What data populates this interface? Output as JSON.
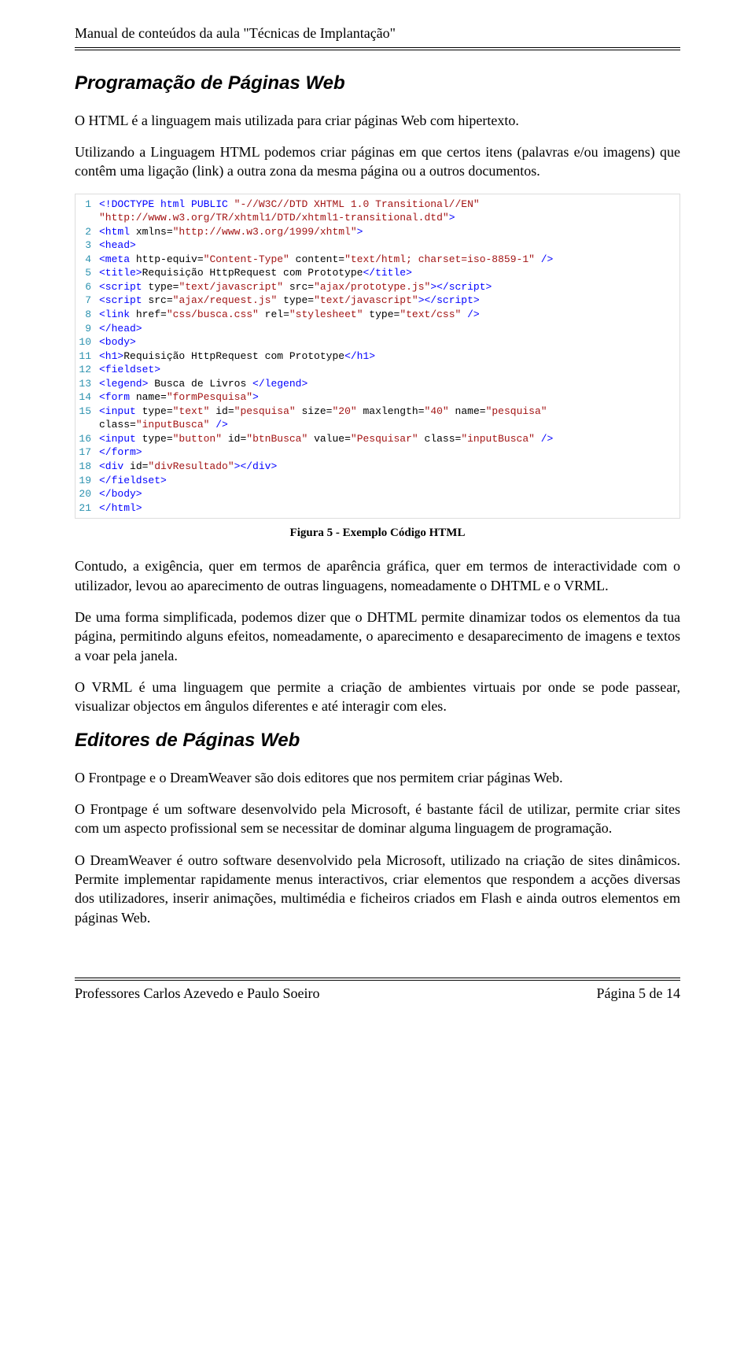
{
  "header": {
    "title": "Manual de conteúdos da aula \"Técnicas de Implantação\""
  },
  "section1": {
    "heading": "Programação de Páginas Web",
    "p1": "O HTML é a linguagem mais utilizada para criar páginas Web com hipertexto.",
    "p2": "Utilizando a Linguagem HTML podemos criar páginas em que certos itens (palavras e/ou imagens) que contêm uma ligação (link) a outra zona da mesma página ou a outros documentos."
  },
  "code": {
    "lines": [
      {
        "n": "1",
        "segs": [
          {
            "c": "blue",
            "t": "<!DOCTYPE html PUBLIC "
          },
          {
            "c": "brown",
            "t": "\"-//W3C//DTD XHTML 1.0 Transitional//EN\""
          }
        ]
      },
      {
        "n": "",
        "segs": [
          {
            "c": "brown",
            "t": "\"http://www.w3.org/TR/xhtml1/DTD/xhtml1-transitional.dtd\""
          },
          {
            "c": "blue",
            "t": ">"
          }
        ]
      },
      {
        "n": "2",
        "segs": [
          {
            "c": "blue",
            "t": "<html "
          },
          {
            "c": "black",
            "t": "xmlns="
          },
          {
            "c": "brown",
            "t": "\"http://www.w3.org/1999/xhtml\""
          },
          {
            "c": "blue",
            "t": ">"
          }
        ]
      },
      {
        "n": "3",
        "segs": [
          {
            "c": "blue",
            "t": "<head>"
          }
        ]
      },
      {
        "n": "4",
        "segs": [
          {
            "c": "blue",
            "t": "<meta "
          },
          {
            "c": "black",
            "t": "http-equiv="
          },
          {
            "c": "brown",
            "t": "\"Content-Type\""
          },
          {
            "c": "black",
            "t": " content="
          },
          {
            "c": "brown",
            "t": "\"text/html; charset=iso-8859-1\""
          },
          {
            "c": "blue",
            "t": " />"
          }
        ]
      },
      {
        "n": "5",
        "segs": [
          {
            "c": "blue",
            "t": "<title>"
          },
          {
            "c": "black",
            "t": "Requisição HttpRequest com Prototype"
          },
          {
            "c": "blue",
            "t": "</title>"
          }
        ]
      },
      {
        "n": "6",
        "segs": [
          {
            "c": "blue",
            "t": "<script "
          },
          {
            "c": "black",
            "t": "type="
          },
          {
            "c": "brown",
            "t": "\"text/javascript\""
          },
          {
            "c": "black",
            "t": " src="
          },
          {
            "c": "brown",
            "t": "\"ajax/prototype.js\""
          },
          {
            "c": "blue",
            "t": "></script>"
          }
        ]
      },
      {
        "n": "7",
        "segs": [
          {
            "c": "blue",
            "t": "<script "
          },
          {
            "c": "black",
            "t": "src="
          },
          {
            "c": "brown",
            "t": "\"ajax/request.js\""
          },
          {
            "c": "black",
            "t": " type="
          },
          {
            "c": "brown",
            "t": "\"text/javascript\""
          },
          {
            "c": "blue",
            "t": "></script>"
          }
        ]
      },
      {
        "n": "8",
        "segs": [
          {
            "c": "blue",
            "t": "<link "
          },
          {
            "c": "black",
            "t": "href="
          },
          {
            "c": "brown",
            "t": "\"css/busca.css\""
          },
          {
            "c": "black",
            "t": " rel="
          },
          {
            "c": "brown",
            "t": "\"stylesheet\""
          },
          {
            "c": "black",
            "t": " type="
          },
          {
            "c": "brown",
            "t": "\"text/css\""
          },
          {
            "c": "blue",
            "t": " />"
          }
        ]
      },
      {
        "n": "9",
        "segs": [
          {
            "c": "blue",
            "t": "</head>"
          }
        ]
      },
      {
        "n": "10",
        "segs": [
          {
            "c": "blue",
            "t": "<body>"
          }
        ]
      },
      {
        "n": "11",
        "segs": [
          {
            "c": "blue",
            "t": "<h1>"
          },
          {
            "c": "black",
            "t": "Requisição HttpRequest com Prototype"
          },
          {
            "c": "blue",
            "t": "</h1>"
          }
        ]
      },
      {
        "n": "12",
        "segs": [
          {
            "c": "blue",
            "t": "<fieldset>"
          }
        ]
      },
      {
        "n": "13",
        "segs": [
          {
            "c": "blue",
            "t": "<legend>"
          },
          {
            "c": "black",
            "t": " Busca de Livros "
          },
          {
            "c": "blue",
            "t": "</legend>"
          }
        ]
      },
      {
        "n": "14",
        "segs": [
          {
            "c": "blue",
            "t": "<form "
          },
          {
            "c": "black",
            "t": "name="
          },
          {
            "c": "brown",
            "t": "\"formPesquisa\""
          },
          {
            "c": "blue",
            "t": ">"
          }
        ]
      },
      {
        "n": "15",
        "segs": [
          {
            "c": "blue",
            "t": "<input "
          },
          {
            "c": "black",
            "t": "type="
          },
          {
            "c": "brown",
            "t": "\"text\""
          },
          {
            "c": "black",
            "t": " id="
          },
          {
            "c": "brown",
            "t": "\"pesquisa\""
          },
          {
            "c": "black",
            "t": " size="
          },
          {
            "c": "brown",
            "t": "\"20\""
          },
          {
            "c": "black",
            "t": " maxlength="
          },
          {
            "c": "brown",
            "t": "\"40\""
          },
          {
            "c": "black",
            "t": " name="
          },
          {
            "c": "brown",
            "t": "\"pesquisa\""
          }
        ]
      },
      {
        "n": "",
        "segs": [
          {
            "c": "black",
            "t": "class="
          },
          {
            "c": "brown",
            "t": "\"inputBusca\""
          },
          {
            "c": "blue",
            "t": " />"
          }
        ]
      },
      {
        "n": "16",
        "segs": [
          {
            "c": "blue",
            "t": "<input "
          },
          {
            "c": "black",
            "t": "type="
          },
          {
            "c": "brown",
            "t": "\"button\""
          },
          {
            "c": "black",
            "t": " id="
          },
          {
            "c": "brown",
            "t": "\"btnBusca\""
          },
          {
            "c": "black",
            "t": " value="
          },
          {
            "c": "brown",
            "t": "\"Pesquisar\""
          },
          {
            "c": "black",
            "t": " class="
          },
          {
            "c": "brown",
            "t": "\"inputBusca\""
          },
          {
            "c": "blue",
            "t": " />"
          }
        ]
      },
      {
        "n": "17",
        "segs": [
          {
            "c": "blue",
            "t": "</form>"
          }
        ]
      },
      {
        "n": "18",
        "segs": [
          {
            "c": "blue",
            "t": "<div "
          },
          {
            "c": "black",
            "t": "id="
          },
          {
            "c": "brown",
            "t": "\"divResultado\""
          },
          {
            "c": "blue",
            "t": "></div>"
          }
        ]
      },
      {
        "n": "19",
        "segs": [
          {
            "c": "blue",
            "t": "</fieldset>"
          }
        ]
      },
      {
        "n": "20",
        "segs": [
          {
            "c": "blue",
            "t": "</body>"
          }
        ]
      },
      {
        "n": "21",
        "segs": [
          {
            "c": "blue",
            "t": "</html>"
          }
        ]
      }
    ],
    "caption": "Figura 5 - Exemplo Código HTML"
  },
  "section1b": {
    "p3": "Contudo, a exigência, quer em termos de aparência gráfica, quer em termos de interactividade com o utilizador, levou ao aparecimento de outras linguagens, nomeadamente o DHTML e o VRML.",
    "p4": "De uma forma simplificada, podemos dizer que o DHTML permite dinamizar todos os elementos da tua página, permitindo alguns efeitos, nomeadamente, o aparecimento e desaparecimento de imagens e textos a voar pela janela.",
    "p5": "O VRML é uma linguagem que permite a criação de ambientes virtuais por onde se pode passear, visualizar objectos em ângulos diferentes e até interagir com eles."
  },
  "section2": {
    "heading": "Editores de Páginas Web",
    "p1": "O Frontpage e o DreamWeaver são dois editores que nos permitem criar páginas Web.",
    "p2": "O Frontpage é um software desenvolvido pela Microsoft, é bastante fácil de utilizar, permite criar sites com um aspecto profissional sem se necessitar de dominar alguma linguagem de programação.",
    "p3": "O DreamWeaver é outro software desenvolvido pela Microsoft, utilizado na criação de sites dinâmicos. Permite implementar rapidamente menus interactivos, criar elementos que respondem a acções diversas dos utilizadores, inserir animações, multimédia e ficheiros criados em Flash e ainda outros elementos em páginas Web."
  },
  "footer": {
    "left": "Professores Carlos Azevedo e Paulo Soeiro",
    "right": "Página 5 de 14"
  }
}
